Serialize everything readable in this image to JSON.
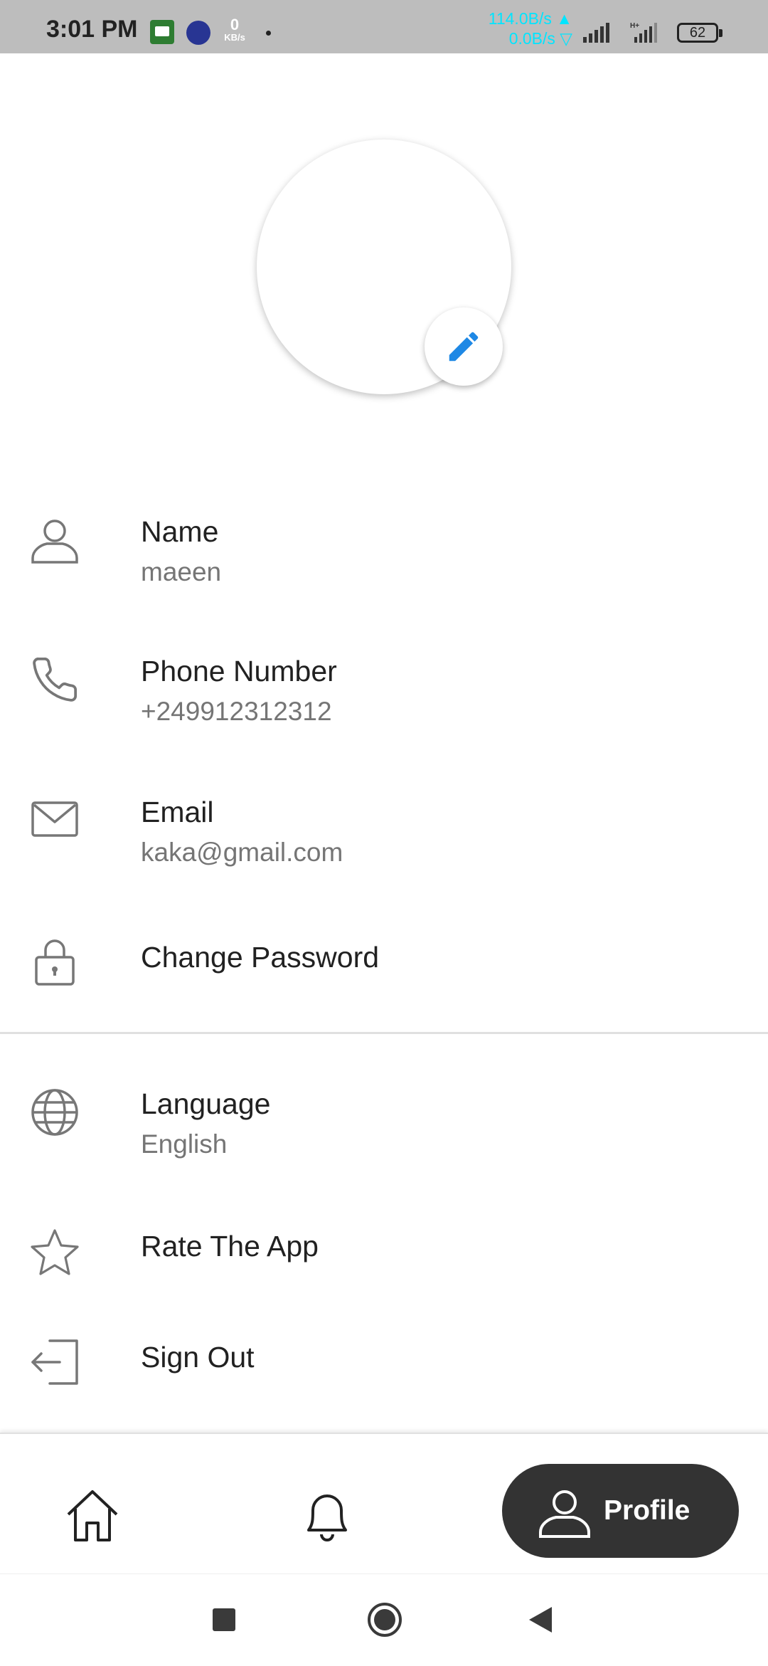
{
  "status_bar": {
    "time": "3:01 PM",
    "net_value": "0",
    "net_unit": "KB/s",
    "upload_speed": "114.0B/s ▲",
    "download_speed": "0.0B/s ▽",
    "battery": "62"
  },
  "profile_items": [
    {
      "title": "Name",
      "subtitle": "maeen",
      "icon": "person-icon"
    },
    {
      "title": "Phone Number",
      "subtitle": "+249912312312",
      "icon": "phone-icon"
    },
    {
      "title": "Email",
      "subtitle": "kaka@gmail.com",
      "icon": "mail-icon"
    },
    {
      "title": "Change Password",
      "icon": "lock-icon"
    }
  ],
  "settings_items": [
    {
      "title": "Language",
      "subtitle": "English",
      "icon": "globe-icon"
    },
    {
      "title": "Rate The App",
      "icon": "star-icon"
    },
    {
      "title": "Sign Out",
      "icon": "sign-out-icon"
    }
  ],
  "bottom_nav": {
    "active_label": "Profile"
  },
  "colors": {
    "accent": "#1e88e5",
    "nav_active_bg": "#333333",
    "status_bar_bg": "#bdbdbd",
    "net_speed": "#00e5ff"
  }
}
